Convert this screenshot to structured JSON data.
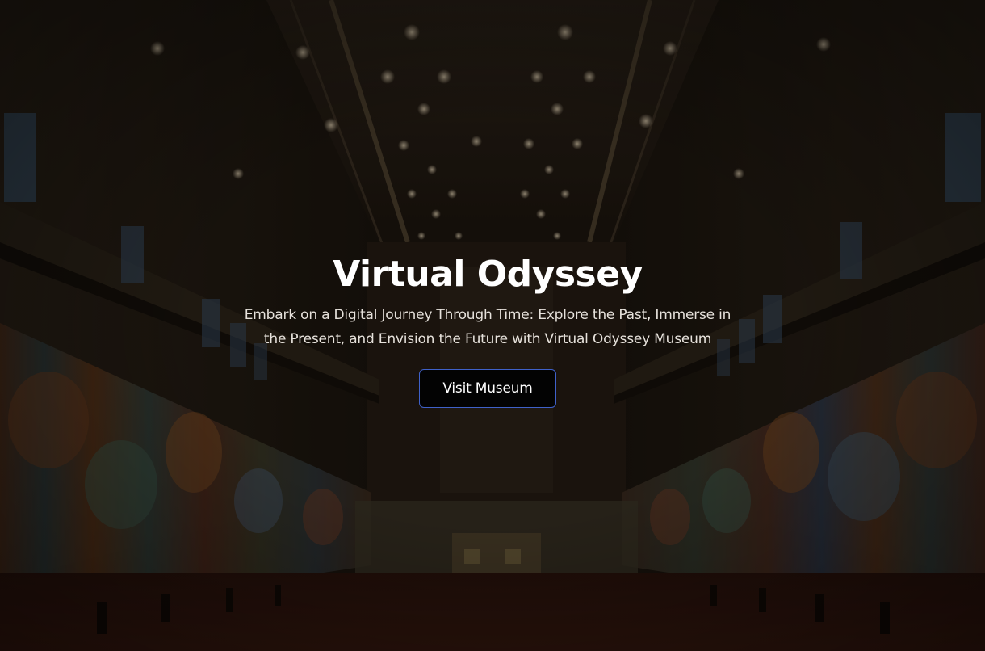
{
  "hero": {
    "title": "Virtual Odyssey",
    "subtitle": "Embark on a Digital Journey Through Time: Explore the Past, Immerse in the Present, and Envision the Future with Virtual Odyssey Museum",
    "cta_label": "Visit Museum",
    "background": "museum-gallery-hall-image"
  },
  "colors": {
    "title_text": "#ffffff",
    "button_background": "#030303",
    "button_border": "#3f61c9"
  }
}
